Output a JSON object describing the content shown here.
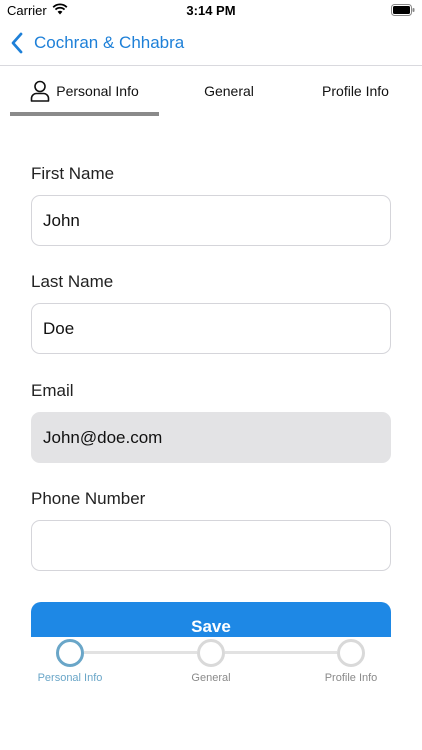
{
  "status_bar": {
    "carrier": "Carrier",
    "time": "3:14 PM",
    "wifi_icon": "wifi-icon",
    "battery_icon": "battery-icon"
  },
  "nav": {
    "back_label": "Cochran & Chhabra",
    "back_icon": "chevron-left-icon",
    "accent_color": "#1e80d8"
  },
  "tabs": [
    {
      "label": "Personal Info",
      "icon": "user-icon",
      "selected": true
    },
    {
      "label": "General",
      "selected": false
    },
    {
      "label": "Profile Info",
      "selected": false
    }
  ],
  "form": {
    "first_name": {
      "label": "First Name",
      "value": "John"
    },
    "last_name": {
      "label": "Last Name",
      "value": "Doe"
    },
    "email": {
      "label": "Email",
      "value": "John@doe.com",
      "disabled": true
    },
    "phone": {
      "label": "Phone Number",
      "value": ""
    },
    "save_label": "Save",
    "save_color": "#1e88e5"
  },
  "stepper": {
    "steps": [
      {
        "label": "Personal Info",
        "active": true
      },
      {
        "label": "General",
        "active": false
      },
      {
        "label": "Profile Info",
        "active": false
      }
    ],
    "active_color": "#6aa6c8"
  }
}
